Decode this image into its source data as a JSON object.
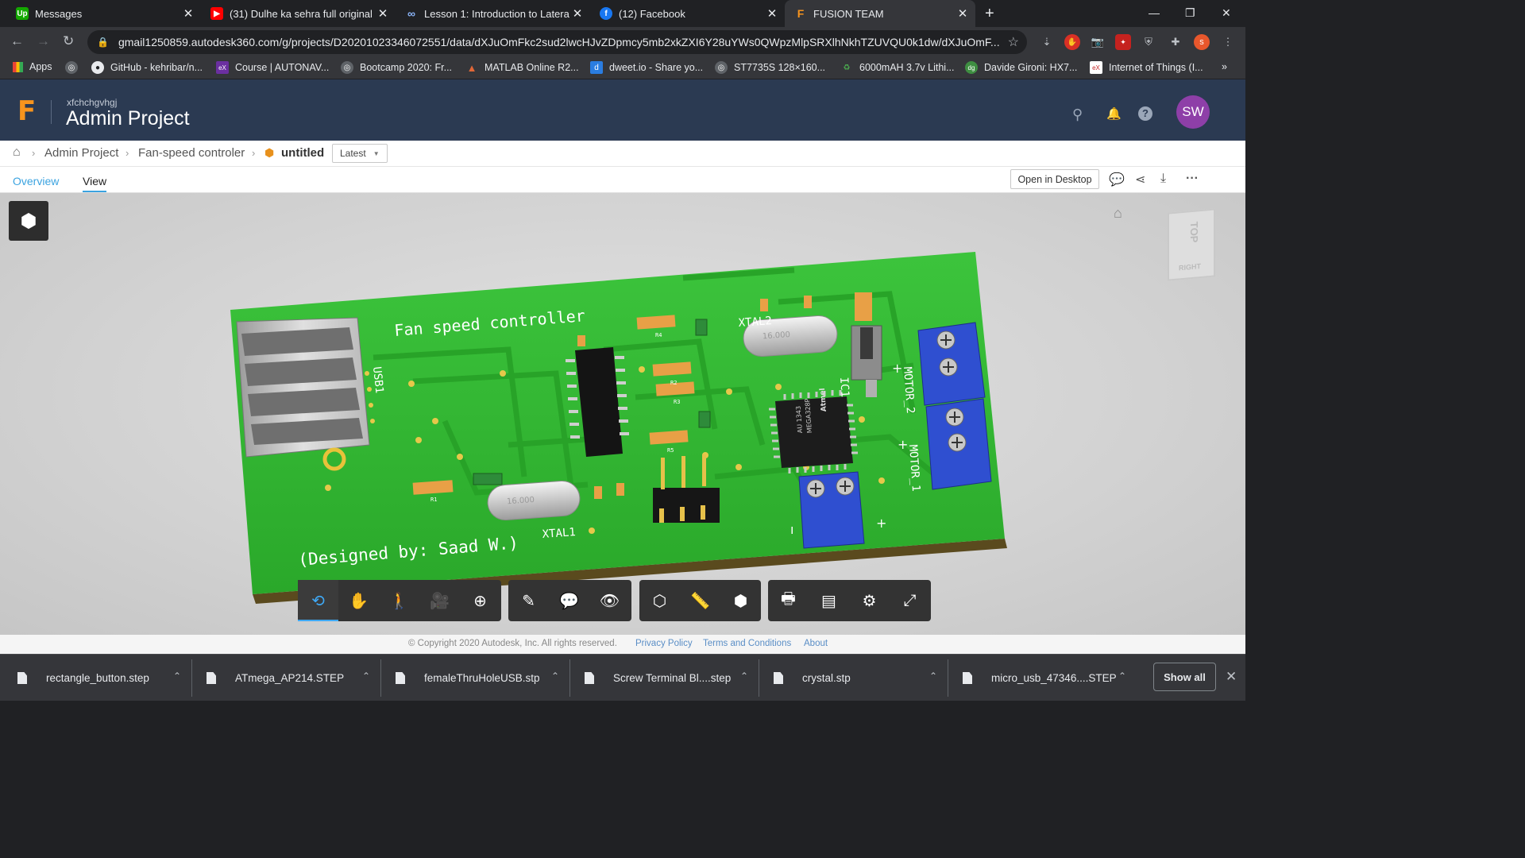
{
  "browser": {
    "tabs": [
      {
        "title": "Messages",
        "icon": "upwork-icon",
        "color": "#14a800",
        "glyph": "Up"
      },
      {
        "title": "(31) Dulhe ka sehra full original b",
        "icon": "youtube-icon",
        "color": "#ff0000",
        "glyph": "▶"
      },
      {
        "title": "Lesson 1: Introduction to Lateral",
        "icon": "coursera-icon",
        "color": "#8ab4f8",
        "glyph": "∞"
      },
      {
        "title": "(12) Facebook",
        "icon": "facebook-icon",
        "color": "#1877f2",
        "glyph": "f"
      },
      {
        "title": "FUSION TEAM",
        "icon": "fusion-icon",
        "color": "#f7941d",
        "glyph": "F"
      }
    ],
    "url": "gmail1250859.autodesk360.com/g/projects/D20201023346072551/data/dXJuOmFkc2sud2lwcHJvZDpmcy5mb2xkZXI6Y28uYWs0QWpzMlpSRXlhNkhTZUVQU0k1dw/dXJuOmF...",
    "profile_letter": "s",
    "bookmarks": [
      {
        "label": "Apps",
        "icon": "apps-grid-icon",
        "color": "#e8eaed"
      },
      {
        "label": "",
        "icon": "globe-icon",
        "color": "#5f6368"
      },
      {
        "label": "GitHub - kehribar/n...",
        "icon": "github-icon",
        "color": "#202124"
      },
      {
        "label": "Course | AUTONAV...",
        "icon": "edx-icon",
        "color": "#6b2fa0"
      },
      {
        "label": "Bootcamp 2020: Fr...",
        "icon": "globe-icon",
        "color": "#5f6368"
      },
      {
        "label": "MATLAB Online R2...",
        "icon": "matlab-icon",
        "color": "#e16737"
      },
      {
        "label": "dweet.io - Share yo...",
        "icon": "dweet-icon",
        "color": "#2a7de1"
      },
      {
        "label": "ST7735S 128×160...",
        "icon": "globe-icon",
        "color": "#5f6368"
      },
      {
        "label": "6000mAH 3.7v Lithi...",
        "icon": "shop-icon",
        "color": "#2e7d32"
      },
      {
        "label": "Davide Gironi: HX7...",
        "icon": "dg-icon",
        "color": "#3e8e41"
      },
      {
        "label": "Internet of Things (I...",
        "icon": "edx-icon",
        "color": "#c62828"
      }
    ]
  },
  "app": {
    "account": "xfchchgvhgj",
    "title": "Admin Project",
    "avatar": "SW",
    "breadcrumb": [
      "Admin Project",
      "Fan-speed controler",
      "untitled"
    ],
    "version": "Latest",
    "tabs": [
      "Overview",
      "View"
    ],
    "open_desktop": "Open in Desktop",
    "viewcube": {
      "top": "TOP",
      "right": "RIGHT"
    }
  },
  "pcb": {
    "title": "Fan speed controller",
    "credit": "(Designed by: Saad W.)",
    "labels": {
      "usb": "USB1",
      "xtal1": "XTAL1",
      "xtal2": "XTAL2",
      "ic1": "IC1",
      "motor1": "MOTOR_1",
      "motor2": "MOTOR_2",
      "chip": "MEGA328P",
      "chip_code": "AU 1343",
      "crystal": "16.000",
      "r1": "R1",
      "r2": "R2",
      "r3": "R3",
      "r4": "R4",
      "r5": "R5"
    },
    "colors": {
      "board": "#2fb82f",
      "mask": "#1f9a1f",
      "terminal": "#2f4fd0"
    }
  },
  "viewer_tools": [
    {
      "name": "orbit-tool",
      "glyph": "⟲"
    },
    {
      "name": "pan-tool",
      "glyph": "✋"
    },
    {
      "name": "walk-tool",
      "glyph": "🚶"
    },
    {
      "name": "camera-tool",
      "glyph": "🎥"
    },
    {
      "name": "zoom-window-tool",
      "glyph": "⊕"
    },
    {
      "name": "markup-tool",
      "glyph": "✎"
    },
    {
      "name": "comment-tool",
      "glyph": "💬"
    },
    {
      "name": "hide-tool",
      "glyph": "👁"
    },
    {
      "name": "section-tool",
      "glyph": "⬡"
    },
    {
      "name": "measure-tool",
      "glyph": "📏"
    },
    {
      "name": "explode-tool",
      "glyph": "⬢"
    },
    {
      "name": "print-tool",
      "glyph": "🖶"
    },
    {
      "name": "model-browser-tool",
      "glyph": "▤"
    },
    {
      "name": "settings-tool",
      "glyph": "⚙"
    },
    {
      "name": "fullscreen-tool",
      "glyph": "⤢"
    }
  ],
  "footer": {
    "copyright": "© Copyright 2020 Autodesk, Inc. All rights reserved.",
    "links": [
      "Privacy Policy",
      "Terms and Conditions",
      "About"
    ]
  },
  "downloads": {
    "files": [
      "rectangle_button.step",
      "ATmega_AP214.STEP",
      "femaleThruHoleUSB.stp",
      "Screw Terminal Bl....step",
      "crystal.stp",
      "micro_usb_47346....STEP"
    ],
    "show_all": "Show all"
  }
}
